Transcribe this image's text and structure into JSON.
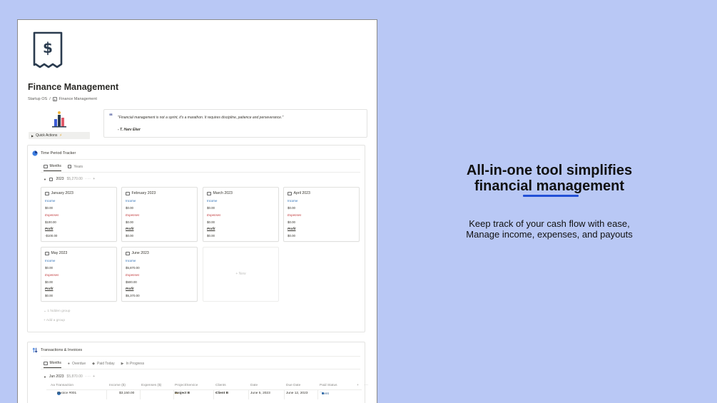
{
  "page": {
    "title": "Finance Management",
    "breadcrumb": [
      "Startup OS",
      "/",
      "Finance Management"
    ],
    "quick_actions_label": "Quick Actions",
    "quick_actions_emoji": "⚡"
  },
  "quote": {
    "text": "\"Financial management is not a sprint, it's a marathon. It requires discipline, patience and perseverance.\"",
    "author": "- T. Harv Eker"
  },
  "time_period_tracker": {
    "title": "Time Period Tracker",
    "tabs": [
      "Months",
      "Years"
    ],
    "group": {
      "label": "2023",
      "amount": "$5,270.00",
      "controls": "··· +"
    },
    "cards": [
      {
        "title": "January 2023",
        "income_label": "Income",
        "income": "$0.00",
        "expenses_label": "Expenses",
        "expenses": "$100.00",
        "profit_label": "Profit",
        "profit": "-$100.00"
      },
      {
        "title": "February 2023",
        "income_label": "Income",
        "income": "$0.00",
        "expenses_label": "Expenses",
        "expenses": "$0.00",
        "profit_label": "Profit",
        "profit": "$0.00"
      },
      {
        "title": "March 2023",
        "income_label": "Income",
        "income": "$0.00",
        "expenses_label": "Expenses",
        "expenses": "$0.00",
        "profit_label": "Profit",
        "profit": "$0.00"
      },
      {
        "title": "April 2023",
        "income_label": "Income",
        "income": "$0.00",
        "expenses_label": "Expenses",
        "expenses": "$0.00",
        "profit_label": "Profit",
        "profit": "$0.00"
      },
      {
        "title": "May 2023",
        "income_label": "Income",
        "income": "$0.00",
        "expenses_label": "Expenses",
        "expenses": "$0.00",
        "profit_label": "Profit",
        "profit": "$0.00"
      },
      {
        "title": "June 2023",
        "income_label": "Income",
        "income": "$5,870.00",
        "expenses_label": "Expenses",
        "expenses": "$500.00",
        "profit_label": "Profit",
        "profit": "$5,370.00"
      }
    ],
    "new_label": "+ New",
    "hidden_group": "1 hidden group",
    "add_group": "+ Add a group"
  },
  "transactions": {
    "title": "Transactions & Invoices",
    "tabs": [
      "Months",
      "Overdue",
      "Paid Today",
      "In Progress"
    ],
    "group": {
      "label": "Jun 2023",
      "amount": "$5,870.00",
      "controls": "··· +"
    },
    "columns": [
      "Aa Transaction",
      "Income ($)",
      "Expenses ($)",
      "Project/Service",
      "Clients",
      "Date",
      "Due Date",
      "Paid Status",
      "+",
      "···"
    ],
    "rows": [
      {
        "transaction": "Invoice #001",
        "income": "$3,150.00",
        "expenses": "",
        "project": "Project B",
        "client": "Client B",
        "date": "June 5, 2023",
        "due": "June 12, 2023",
        "status": "Sent"
      }
    ]
  },
  "marketing": {
    "headline_line1": "All-in-one tool simplifies",
    "headline_line2": "financial management",
    "sub_line1": "Keep track of your cash flow with ease,",
    "sub_line2": "Manage income, expenses, and payouts"
  },
  "colors": {
    "background": "#b9c8f5",
    "accent": "#2350d6",
    "income": "#2e6fb5",
    "expenses": "#c0393b"
  }
}
